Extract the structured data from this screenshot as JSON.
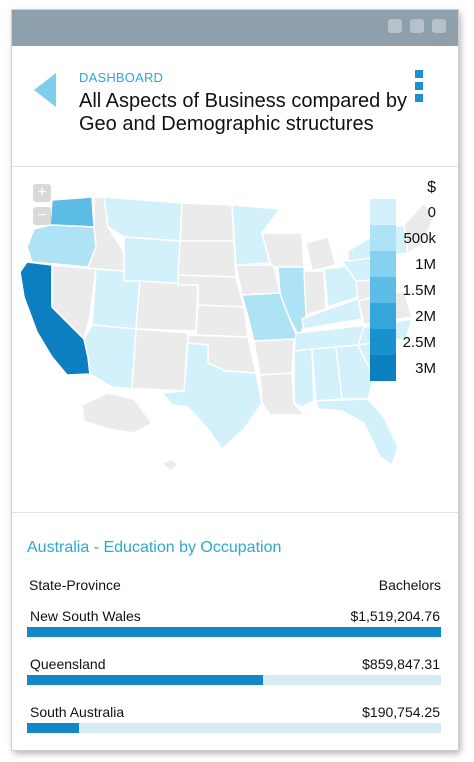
{
  "header": {
    "breadcrumb": "DASHBOARD",
    "title": "All Aspects of Business compared by Geo and Demographic structures"
  },
  "map": {
    "legend_title": "$",
    "legend": [
      {
        "label": "0",
        "color": "#d2f1fb"
      },
      {
        "label": "500k",
        "color": "#aee2f5"
      },
      {
        "label": "1M",
        "color": "#86d1ef"
      },
      {
        "label": "1.5M",
        "color": "#5dbce6"
      },
      {
        "label": "2M",
        "color": "#35a6da"
      },
      {
        "label": "2.5M",
        "color": "#1a90cc"
      },
      {
        "label": "3M",
        "color": "#0b7fbf"
      }
    ],
    "zoom_in_symbol": "+",
    "zoom_out_symbol": "−",
    "state_colors": {
      "no_data": "#ebebeb",
      "washington": "#5dbce6",
      "oregon": "#aee2f5",
      "california": "#0b7fbf",
      "low": "#d2f1fb",
      "mid": "#aee2f5"
    }
  },
  "education": {
    "title": "Australia - Education by Occupation",
    "col_left": "State-Province",
    "col_right": "Bachelors",
    "rows": [
      {
        "name": "New South Wales",
        "value": "$1,519,204.76",
        "fraction": 1.0
      },
      {
        "name": "Queensland",
        "value": "$859,847.31",
        "fraction": 0.57
      },
      {
        "name": "South Australia",
        "value": "$190,754.25",
        "fraction": 0.126
      }
    ]
  }
}
